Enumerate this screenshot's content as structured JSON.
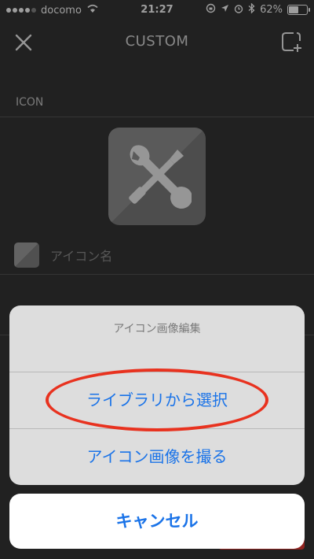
{
  "status_bar": {
    "carrier": "docomo",
    "time": "21:27",
    "battery": "62%",
    "battery_level": 0.62
  },
  "nav": {
    "title": "CUSTOM",
    "close_icon": "close-icon",
    "new_icon": "new-square-icon"
  },
  "icon_section": {
    "label": "ICON",
    "preview_icon": "wrench-screwdriver-icon"
  },
  "name_field": {
    "placeholder": "アイコン名",
    "value": ""
  },
  "action_sheet": {
    "title": "アイコン画像編集",
    "options": [
      {
        "label": "ライブラリから選択"
      },
      {
        "label": "アイコン画像を撮る"
      }
    ],
    "cancel_label": "キャンセル",
    "accent_color": "#1a73e8"
  },
  "annotation": {
    "highlight_color": "#e8321f"
  }
}
